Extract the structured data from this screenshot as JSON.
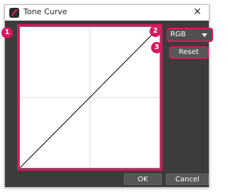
{
  "window": {
    "title": "Tone Curve",
    "close_glyph": "✕"
  },
  "curve": {
    "points": [
      [
        0,
        0
      ],
      [
        255,
        255
      ]
    ],
    "range": [
      0,
      255
    ],
    "grid_divisions": 2
  },
  "controls": {
    "channel_value": "RGB",
    "reset_label": "Reset",
    "ok_label": "OK",
    "cancel_label": "Cancel"
  },
  "badges": [
    "1",
    "2",
    "3"
  ],
  "colors": {
    "highlight": "#d8185e",
    "panel_bg": "#3c3c3c",
    "curve": "#000000",
    "grid": "#d9d9d9"
  },
  "icons": {
    "app": "tone-curve-app-icon",
    "close": "close-icon",
    "dropdown": "chevron-down-icon"
  }
}
